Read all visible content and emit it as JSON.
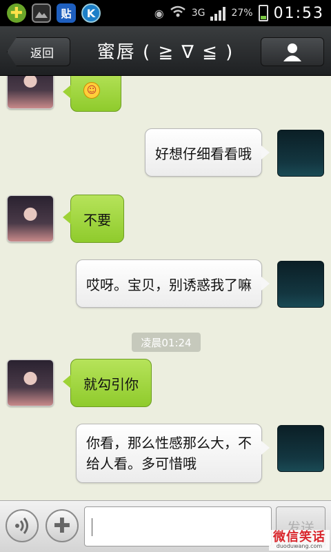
{
  "status_bar": {
    "network": "3G",
    "battery": "27%",
    "time": "01:53",
    "app_icons": [
      "plus-app-icon",
      "gallery-icon",
      "tieba-icon",
      "k-app-icon"
    ]
  },
  "header": {
    "back_label": "返回",
    "title": "蜜唇 ( ≧ ∇ ≦ )"
  },
  "messages": [
    {
      "from": "contact",
      "type": "emoji",
      "text": ""
    },
    {
      "from": "me",
      "text": "好想仔细看看哦"
    },
    {
      "from": "contact",
      "text": "不要"
    },
    {
      "from": "me",
      "text": "哎呀。宝贝，别诱惑我了嘛"
    },
    {
      "from": "contact",
      "text": "就勾引你"
    },
    {
      "from": "me",
      "text_line1": "你看，那么性感那么大，不",
      "text_line2": "给人看。多可惜哦"
    }
  ],
  "timestamp": "凌晨01:24",
  "input_bar": {
    "value": "",
    "send_label": "发送"
  },
  "watermark": {
    "main": "微信笑话",
    "sub": "duoduwang.com"
  }
}
